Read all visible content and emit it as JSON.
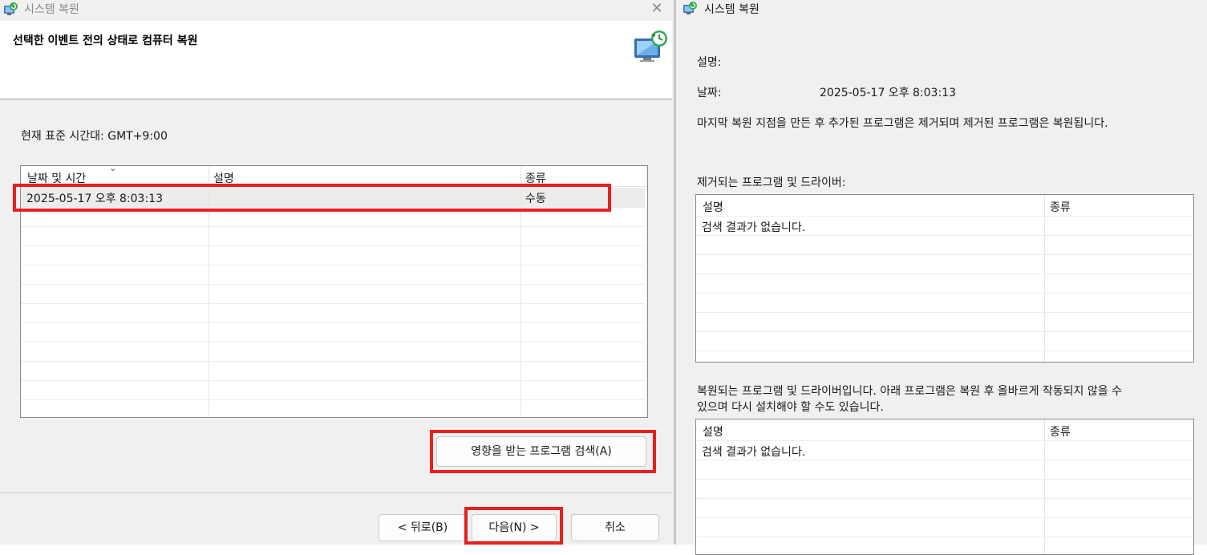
{
  "left_window": {
    "title": "시스템 복원",
    "close_glyph": "✕",
    "header_title": "선택한 이벤트 전의 상태로 컴퓨터 복원",
    "timezone": "현재 표준 시간대: GMT+9:00",
    "columns": {
      "date": "날짜 및 시간",
      "description": "설명",
      "type": "종류"
    },
    "sort_glyph": "⌄",
    "rows": [
      {
        "date": "2025-05-17 오후 8:03:13",
        "description": "",
        "type": "수동"
      }
    ],
    "scan_button": "영향을 받는 프로그램 검색(A)",
    "back_button": "< 뒤로(B)",
    "next_button": "다음(N) >",
    "cancel_button": "취소"
  },
  "right_window": {
    "title": "시스템 복원",
    "description_label": "설명:",
    "date_label": "날짜:",
    "date_value": "2025-05-17 오후 8:03:13",
    "summary": "마지막 복원 지점을 만든 후 추가된 프로그램은 제거되며 제거된 프로그램은 복원됩니다.",
    "removed_label": "제거되는 프로그램 및 드라이버:",
    "removed_columns": {
      "description": "설명",
      "type": "종류"
    },
    "removed_empty": "검색 결과가 없습니다.",
    "restored_label_line1": "복원되는 프로그램 및 드라이버입니다. 아래 프로그램은 복원 후 올바르게 작동되지 않을 수",
    "restored_label_line2": "있으며 다시 설치해야 할 수도 있습니다.",
    "restored_columns": {
      "description": "설명",
      "type": "종류"
    },
    "restored_empty": "검색 결과가 없습니다."
  },
  "icons": {
    "title_icon": "system-restore-icon",
    "header_icon": "monitor-restore-icon"
  },
  "colors": {
    "highlight_red": "#e81f1f",
    "selected_row": "#ececec",
    "window_bg": "#f0f0f0"
  }
}
